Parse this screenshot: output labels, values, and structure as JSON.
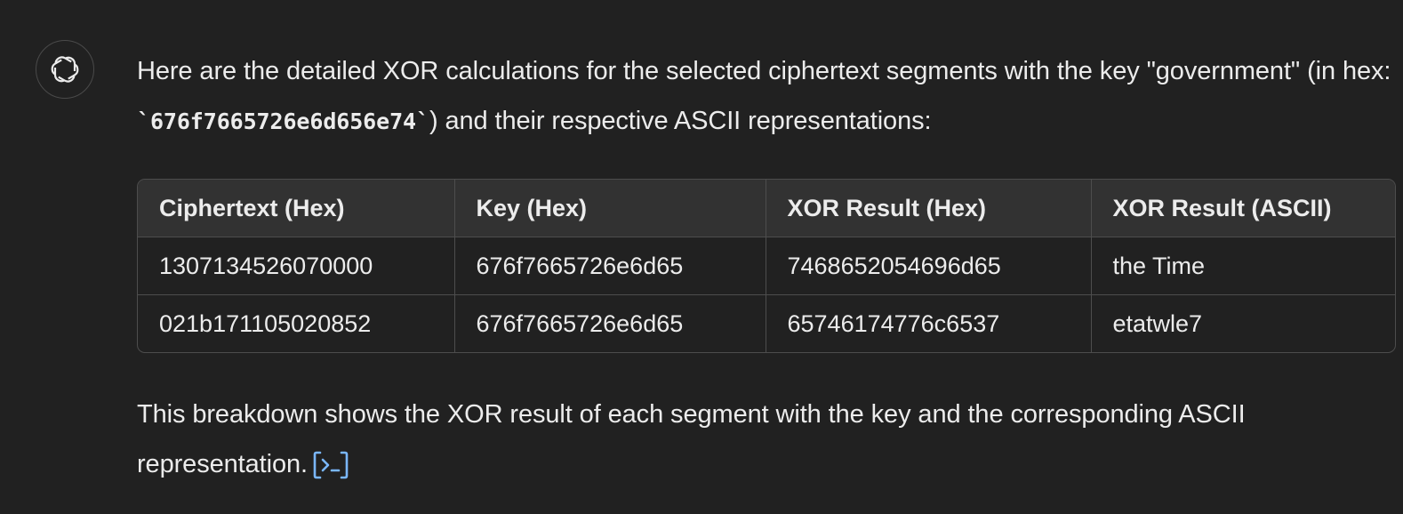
{
  "message": {
    "intro_part1": "Here are the detailed XOR calculations for the selected ciphertext segments with the key \"government\" (in hex: ",
    "key_hex_code": "`676f7665726e6d656e74`",
    "intro_part2": ") and their respective ASCII representations:",
    "summary": "This breakdown shows the XOR result of each segment with the key and the corresponding ASCII representation.",
    "analysis_icon": "code-analysis-icon"
  },
  "table": {
    "headers": [
      "Ciphertext (Hex)",
      "Key (Hex)",
      "XOR Result (Hex)",
      "XOR Result (ASCII)"
    ],
    "rows": [
      [
        "1307134526070000",
        "676f7665726e6d65",
        "7468652054696d65",
        "the Time"
      ],
      [
        "021b171105020852",
        "676f7665726e6d65",
        "65746174776c6537",
        "etatwle7"
      ]
    ]
  },
  "colors": {
    "background": "#212121",
    "text": "#ececec",
    "header_bg": "#323232",
    "border": "#4d4d4d",
    "link_accent": "#7ab7ff"
  },
  "avatar_icon": "openai-logo-icon"
}
